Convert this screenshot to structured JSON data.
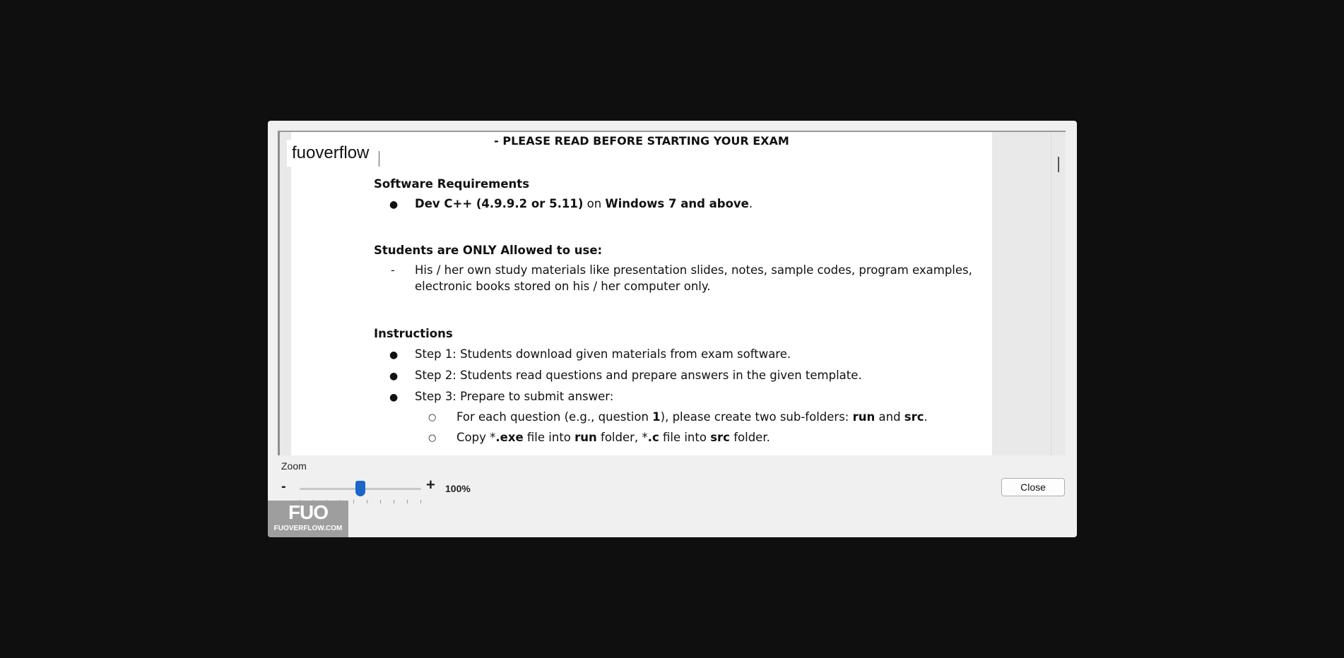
{
  "document": {
    "title": "- PLEASE READ BEFORE STARTING YOUR EXAM",
    "software_heading": "Software Requirements",
    "software_item": {
      "dev": "Dev C++ (4.9.9.2 or 5.11)",
      "on": " on ",
      "windows": "Windows 7 and above",
      "end": "."
    },
    "allowed_heading": "Students are ONLY Allowed to use:",
    "allowed_line1": "His / her own study materials like presentation slides, notes, sample codes, program examples,",
    "allowed_line2": "electronic books stored on his / her computer only.",
    "instructions_heading": "Instructions",
    "steps": [
      "Step 1: Students download given materials from exam software.",
      "Step 2: Students read questions and prepare answers in the given template.",
      "Step 3: Prepare to submit answer:"
    ],
    "sub1": {
      "a": "For each question (e.g., question ",
      "b": "1",
      "c": "), please create two sub-folders: ",
      "d": "run",
      "e": " and ",
      "f": "src",
      "g": "."
    },
    "sub2": {
      "a": "Copy *",
      "b": ".exe",
      "c": " file into ",
      "d": "run",
      "e": " folder, *",
      "f": ".c",
      "g": " file into ",
      "h": "src",
      "i": " folder."
    },
    "bullet_char": "●",
    "dash_char": "-",
    "circle_char": "○"
  },
  "overlay_brand": "fuoverflow",
  "zoom": {
    "label": "Zoom",
    "minus": "-",
    "plus": "+",
    "value": "100%",
    "slider_position": 0.5
  },
  "close_button": "Close",
  "watermark": {
    "logo": "FUO",
    "text": "FUOVERFLOW.COM"
  },
  "colors": {
    "backdrop": "#0f0f0f",
    "dialog": "#f0f0f0",
    "slider_thumb": "#1a66c9"
  }
}
